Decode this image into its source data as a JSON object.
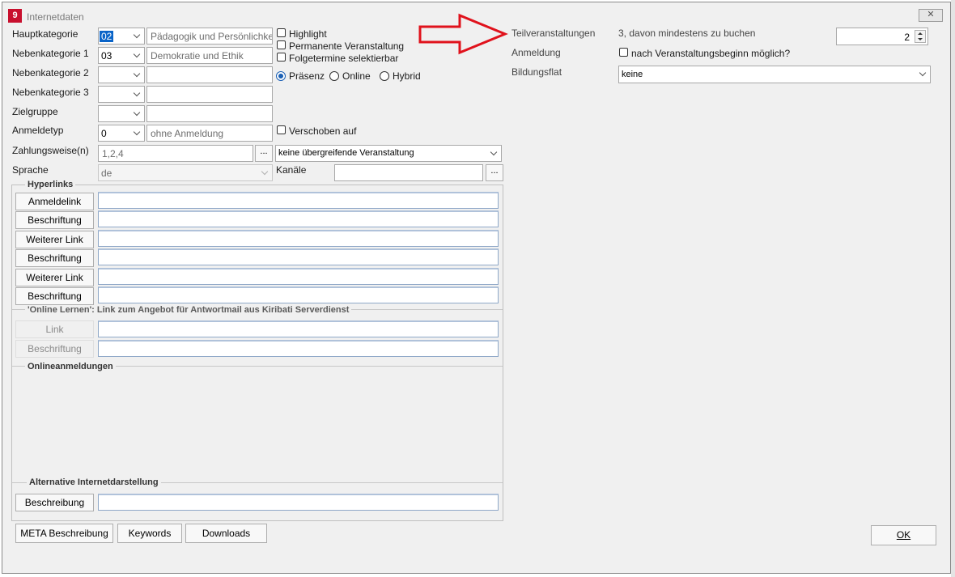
{
  "window": {
    "title": "Internetdaten",
    "app_icon": "9",
    "close_glyph": "✕"
  },
  "left": {
    "hauptkategorie": {
      "label": "Hauptkategorie",
      "code": "02",
      "text": "Pädagogik und Persönlichkeit"
    },
    "nebenkategorie1": {
      "label": "Nebenkategorie 1",
      "code": "03",
      "text": "Demokratie und Ethik"
    },
    "nebenkategorie2": {
      "label": "Nebenkategorie 2",
      "code": "",
      "text": ""
    },
    "nebenkategorie3": {
      "label": "Nebenkategorie 3",
      "code": "",
      "text": ""
    },
    "zielgruppe": {
      "label": "Zielgruppe",
      "code": "",
      "text": ""
    },
    "anmeldetyp": {
      "label": "Anmeldetyp",
      "code": "0",
      "text": "ohne Anmeldung"
    },
    "zahlungsweise": {
      "label": "Zahlungsweise(n)",
      "value": "1,2,4",
      "dots": "..."
    },
    "sprache": {
      "label": "Sprache",
      "value": "de"
    }
  },
  "middle": {
    "highlight": "Highlight",
    "permanente": "Permanente Veranstaltung",
    "folgetermine": "Folgetermine selektierbar",
    "radio": {
      "praesenz": "Präsenz",
      "online": "Online",
      "hybrid": "Hybrid"
    },
    "verschoben": "Verschoben auf",
    "uebergreifend": "keine übergreifende Veranstaltung",
    "kanaele": {
      "label": "Kanäle",
      "dots": "..."
    }
  },
  "hyperlinks": {
    "title": "Hyperlinks",
    "buttons": [
      "Anmeldelink",
      "Beschriftung",
      "Weiterer Link",
      "Beschriftung",
      "Weiterer Link",
      "Beschriftung"
    ]
  },
  "online_lernen": {
    "title": "'Online Lernen': Link zum Angebot für Antwortmail aus Kiribati Serverdienst",
    "link": "Link",
    "beschriftung": "Beschriftung"
  },
  "onlineanmeldungen": {
    "title": "Onlineanmeldungen"
  },
  "alternative": {
    "title": "Alternative Internetdarstellung",
    "beschreibung": "Beschreibung"
  },
  "bottom_buttons": {
    "meta": "META Beschreibung",
    "keywords": "Keywords",
    "downloads": "Downloads",
    "ok": "OK"
  },
  "right": {
    "teilveranstaltungen": {
      "label": "Teilveranstaltungen",
      "text": "3, davon mindestens zu buchen",
      "spin": "2"
    },
    "anmeldung": {
      "label": "Anmeldung",
      "checkbox": "nach Veranstaltungsbeginn möglich?"
    },
    "bildungsflat": {
      "label": "Bildungsflat",
      "value": "keine"
    }
  },
  "annotation": {
    "color": "#e0121c"
  }
}
